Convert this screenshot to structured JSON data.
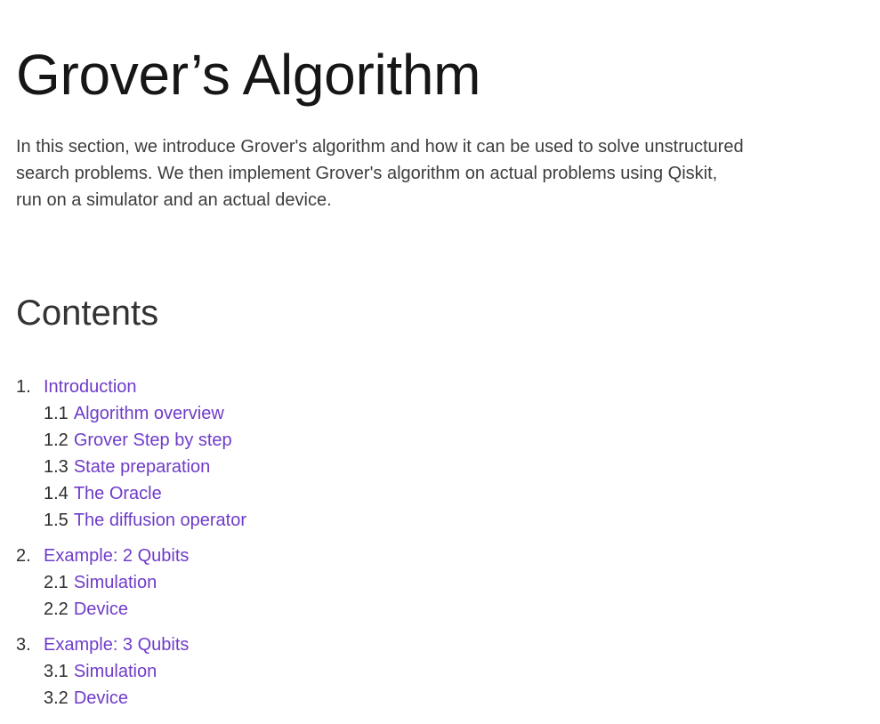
{
  "title": "Grover’s Algorithm",
  "intro": {
    "line1": "In this section, we introduce Grover's algorithm and how it can be used to solve unstructured",
    "line2": "search problems. We then implement Grover's algorithm on actual problems using Qiskit,",
    "line3": "run on a simulator and an actual device."
  },
  "contents_heading": "Contents",
  "toc": [
    {
      "num": "1.",
      "label": "Introduction",
      "subs": [
        {
          "num": "1.1",
          "label": "Algorithm overview"
        },
        {
          "num": "1.2",
          "label": "Grover Step by step"
        },
        {
          "num": "1.3",
          "label": "State preparation"
        },
        {
          "num": "1.4",
          "label": "The Oracle"
        },
        {
          "num": "1.5",
          "label": "The diffusion operator"
        }
      ]
    },
    {
      "num": "2.",
      "label": "Example: 2 Qubits",
      "subs": [
        {
          "num": "2.1",
          "label": "Simulation"
        },
        {
          "num": "2.2",
          "label": "Device"
        }
      ]
    },
    {
      "num": "3.",
      "label": "Example: 3 Qubits",
      "subs": [
        {
          "num": "3.1",
          "label": "Simulation"
        },
        {
          "num": "3.2",
          "label": "Device"
        }
      ]
    }
  ],
  "colors": {
    "link": "#6f3cc9",
    "text": "#3d3d3d",
    "title": "#161616"
  }
}
